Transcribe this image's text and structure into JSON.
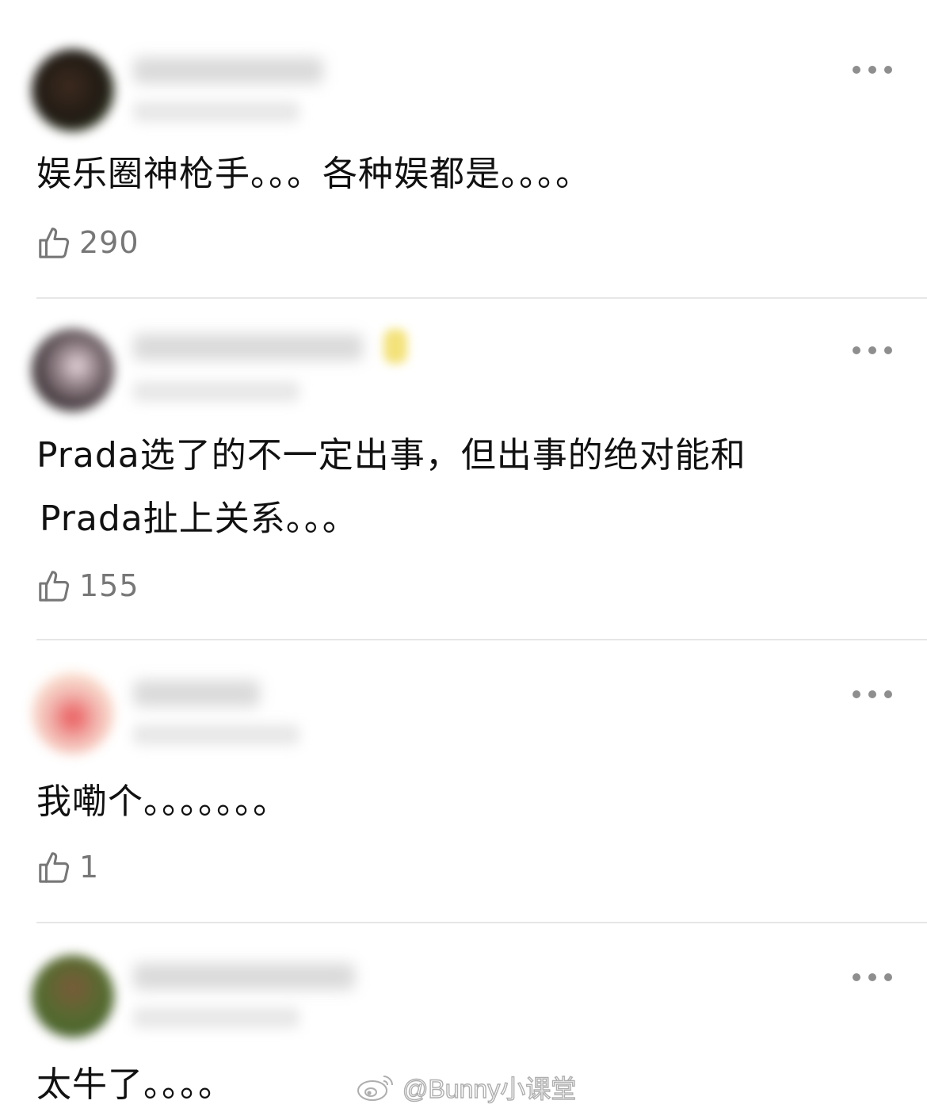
{
  "comments": [
    {
      "lines": [
        "娱乐圈神枪手。。。各种娱都是。。。。"
      ],
      "likes": "290"
    },
    {
      "lines": [
        "Prada选了的不一定出事，但出事的绝对能和",
        "Prada扯上关系。。。"
      ],
      "likes": "155"
    },
    {
      "lines": [
        "我嘞个。。。。。。。"
      ],
      "likes": "1"
    },
    {
      "lines": [
        "太牛了。。。。"
      ]
    }
  ],
  "watermark": {
    "text": "@Bunny小课堂",
    "icon": "weibo-icon"
  },
  "icons": {
    "more": "more-icon",
    "like": "thumbs-up-icon"
  },
  "colors": {
    "text": "#111111",
    "muted": "#777777",
    "divider": "#e6e6e6",
    "dots": "#8e8e8e"
  }
}
